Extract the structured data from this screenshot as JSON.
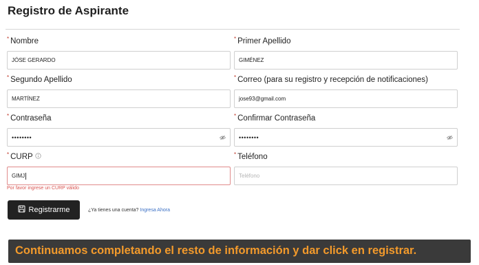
{
  "form": {
    "title": "Registro de Aspirante",
    "fields": {
      "nombre": {
        "label": "Nombre",
        "value": "JÓSE GERARDO"
      },
      "primer_apellido": {
        "label": "Primer Apellido",
        "value": "GIMÉNEZ"
      },
      "segundo_apellido": {
        "label": "Segundo Apellido",
        "value": "MARTÍNEZ"
      },
      "correo": {
        "label": "Correo (para su registro y recepción de notificaciones)",
        "value": "jose93@gmail.com"
      },
      "contrasena": {
        "label": "Contraseña",
        "value": "••••••••"
      },
      "confirmar_contrasena": {
        "label": "Confirmar Contraseña",
        "value": "••••••••"
      },
      "curp": {
        "label": "CURP",
        "value": "GIMJ",
        "error": "Por favor ingrese un CURP válido"
      },
      "telefono": {
        "label": "Teléfono",
        "placeholder": "Teléfono"
      }
    },
    "submit_label": "Registrarme",
    "login_prompt": "¿Ya tienes una cuenta?",
    "login_link": "Ingresa Ahora",
    "required_mark": "*"
  },
  "caption": "Continuamos completando el resto de información y dar click en registrar.",
  "icons": {
    "eye": "eye-icon",
    "info": "info-icon",
    "save": "save-icon"
  },
  "colors": {
    "error": "#d9534f",
    "button_bg": "#222222",
    "link": "#3a6fc4",
    "caption_text": "#f39a2b",
    "caption_bg": "#3a3a3a"
  }
}
